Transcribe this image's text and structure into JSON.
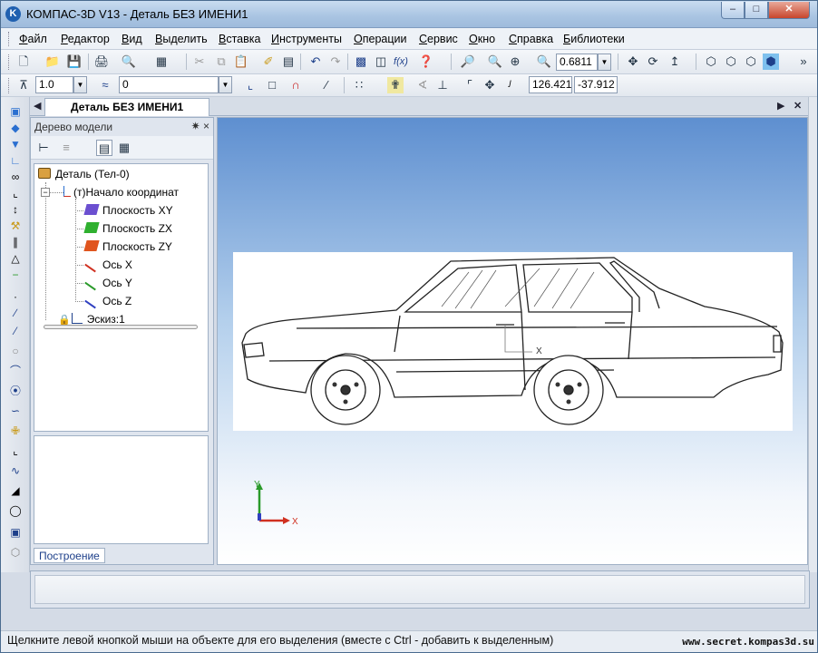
{
  "window": {
    "title": "КОМПАС-3D V13 - Деталь БЕЗ ИМЕНИ1",
    "logo_letter": "K"
  },
  "menu": [
    "Файл",
    "Редактор",
    "Вид",
    "Выделить",
    "Вставка",
    "Инструменты",
    "Операции",
    "Сервис",
    "Окно",
    "Справка",
    "Библиотеки"
  ],
  "toolbar": {
    "zoom_value": "0.6811",
    "step_value": "1.0",
    "layer_value": "0",
    "coord_x": "126.421",
    "coord_y": "-37.912"
  },
  "doc_tab": {
    "label": "Деталь БЕЗ ИМЕНИ1"
  },
  "tree": {
    "header": "Дерево модели",
    "header_buttons": "✷ ×",
    "items": [
      {
        "label": "Деталь (Тел-0)",
        "icon": "part-icon"
      },
      {
        "label": "(т)Начало координат",
        "icon": "origin-icon"
      },
      {
        "label": "Плоскость XY",
        "icon": "plane-xy-icon",
        "color": "#6b4fd0"
      },
      {
        "label": "Плоскость ZX",
        "icon": "plane-zx-icon",
        "color": "#2fb02f"
      },
      {
        "label": "Плоскость ZY",
        "icon": "plane-zy-icon",
        "color": "#e0551e"
      },
      {
        "label": "Ось X",
        "icon": "axis-x-icon",
        "color": "#d03020"
      },
      {
        "label": "Ось Y",
        "icon": "axis-y-icon",
        "color": "#2a9a2a"
      },
      {
        "label": "Ось Z",
        "icon": "axis-z-icon",
        "color": "#3040c0"
      },
      {
        "label": "Эскиз:1",
        "icon": "sketch-icon"
      }
    ],
    "bottom_tab": "Построение"
  },
  "viewport": {
    "sketch_axis_label": "X",
    "gizmo": {
      "x_label": "X",
      "y_label": "Y"
    }
  },
  "status": {
    "text": "Щелкните левой кнопкой мыши на объекте для его выделения (вместе с Ctrl - добавить к выделенным)",
    "watermark": "www.secret.kompas3d.su"
  }
}
